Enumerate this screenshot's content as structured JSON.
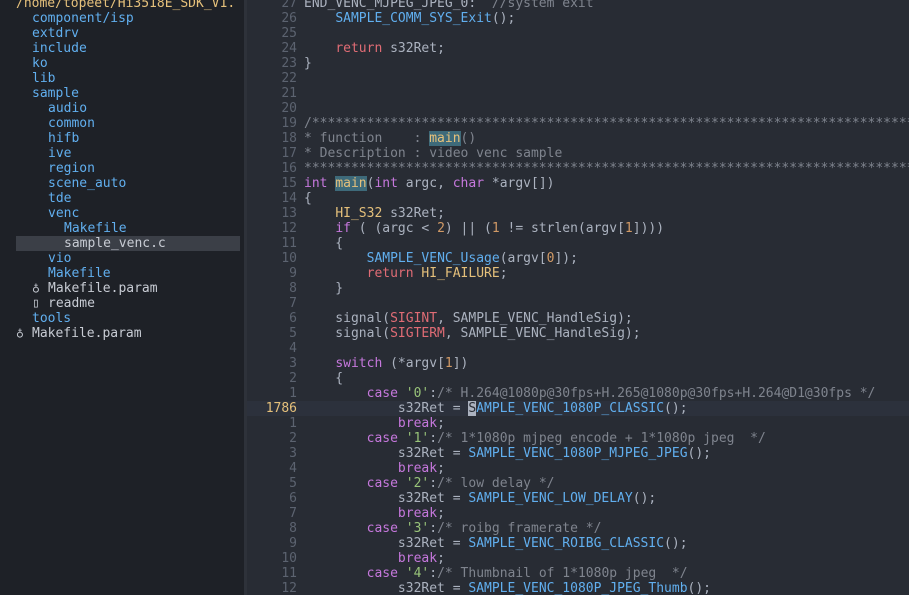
{
  "sidebar": {
    "items": [
      {
        "name": "/home/topeet/Hi3518E_SDK_V1.",
        "kind": "root",
        "depth": 0
      },
      {
        "name": "component/isp",
        "kind": "dir",
        "depth": 1
      },
      {
        "name": "extdrv",
        "kind": "dir",
        "depth": 1
      },
      {
        "name": "include",
        "kind": "dir",
        "depth": 1
      },
      {
        "name": "ko",
        "kind": "dir",
        "depth": 1
      },
      {
        "name": "lib",
        "kind": "dir",
        "depth": 1
      },
      {
        "name": "sample",
        "kind": "dir",
        "depth": 1
      },
      {
        "name": "audio",
        "kind": "dir",
        "depth": 2
      },
      {
        "name": "common",
        "kind": "dir",
        "depth": 2
      },
      {
        "name": "hifb",
        "kind": "dir",
        "depth": 2
      },
      {
        "name": "ive",
        "kind": "dir",
        "depth": 2
      },
      {
        "name": "region",
        "kind": "dir",
        "depth": 2
      },
      {
        "name": "scene_auto",
        "kind": "dir",
        "depth": 2
      },
      {
        "name": "tde",
        "kind": "dir",
        "depth": 2
      },
      {
        "name": "venc",
        "kind": "dir",
        "depth": 2
      },
      {
        "name": "Makefile",
        "kind": "dir",
        "depth": 3
      },
      {
        "name": "sample_venc.c",
        "kind": "file",
        "depth": 3,
        "selected": true
      },
      {
        "name": "vio",
        "kind": "dir",
        "depth": 2
      },
      {
        "name": "Makefile",
        "kind": "dir",
        "depth": 2
      },
      {
        "name": "Makefile.param",
        "kind": "file",
        "depth": 2,
        "glyph": "♁"
      },
      {
        "name": "readme",
        "kind": "file",
        "depth": 2,
        "glyph": "▯"
      },
      {
        "name": "tools",
        "kind": "dir",
        "depth": 1
      },
      {
        "name": "Makefile.param",
        "kind": "file",
        "depth": 1,
        "glyph": "♁"
      }
    ]
  },
  "editor": {
    "lines": [
      {
        "n": "27",
        "s": [
          [
            "END_VENC_MJPEG_JPEG_0:  ",
            ""
          ],
          [
            "//system exit",
            "cm"
          ]
        ]
      },
      {
        "n": "26",
        "s": [
          [
            "    ",
            ""
          ],
          [
            "SAMPLE_COMM_SYS_Exit",
            "fn"
          ],
          [
            "();",
            ""
          ]
        ]
      },
      {
        "n": "25",
        "s": []
      },
      {
        "n": "24",
        "s": [
          [
            "    ",
            ""
          ],
          [
            "return",
            "mac"
          ],
          [
            " s32Ret;",
            ""
          ]
        ]
      },
      {
        "n": "23",
        "s": [
          [
            "}",
            ""
          ]
        ]
      },
      {
        "n": "22",
        "s": []
      },
      {
        "n": "21",
        "s": []
      },
      {
        "n": "20",
        "s": []
      },
      {
        "n": "19",
        "s": [
          [
            "/**************************************************************************************",
            "cm"
          ]
        ]
      },
      {
        "n": "18",
        "s": [
          [
            "* function    : ",
            "cm"
          ],
          [
            "main",
            "hl"
          ],
          [
            "()",
            "cm"
          ]
        ]
      },
      {
        "n": "17",
        "s": [
          [
            "* Description : video venc sample",
            "cm"
          ]
        ]
      },
      {
        "n": "16",
        "s": [
          [
            "**************************************************************************************",
            "cm"
          ]
        ]
      },
      {
        "n": "15",
        "s": [
          [
            "int",
            "k"
          ],
          [
            " ",
            ""
          ],
          [
            "main",
            "hl"
          ],
          [
            "(",
            ""
          ],
          [
            "int",
            "k"
          ],
          [
            " argc, ",
            ""
          ],
          [
            "char",
            "k"
          ],
          [
            " *argv[])",
            ""
          ]
        ]
      },
      {
        "n": "14",
        "s": [
          [
            "{",
            ""
          ]
        ]
      },
      {
        "n": "13",
        "s": [
          [
            "    ",
            ""
          ],
          [
            "HI_S32",
            "t"
          ],
          [
            " s32Ret;",
            ""
          ]
        ]
      },
      {
        "n": "12",
        "s": [
          [
            "    ",
            ""
          ],
          [
            "if",
            "k"
          ],
          [
            " ( (argc < ",
            ""
          ],
          [
            "2",
            "cn"
          ],
          [
            ") || (",
            ""
          ],
          [
            "1",
            "cn"
          ],
          [
            " != strlen(argv[",
            ""
          ],
          [
            "1",
            "cn"
          ],
          [
            "])))",
            ""
          ]
        ]
      },
      {
        "n": "11",
        "s": [
          [
            "    {",
            ""
          ]
        ]
      },
      {
        "n": "10",
        "s": [
          [
            "        ",
            ""
          ],
          [
            "SAMPLE_VENC_Usage",
            "fn"
          ],
          [
            "(argv[",
            ""
          ],
          [
            "0",
            "cn"
          ],
          [
            "]);",
            ""
          ]
        ]
      },
      {
        "n": "9",
        "s": [
          [
            "        ",
            ""
          ],
          [
            "return",
            "mac"
          ],
          [
            " ",
            ""
          ],
          [
            "HI_FAILURE",
            "t"
          ],
          [
            ";",
            ""
          ]
        ]
      },
      {
        "n": "8",
        "s": [
          [
            "    }",
            ""
          ]
        ]
      },
      {
        "n": "7",
        "s": []
      },
      {
        "n": "6",
        "s": [
          [
            "    signal(",
            ""
          ],
          [
            "SIGINT",
            "mac"
          ],
          [
            ", SAMPLE_VENC_HandleSig);",
            ""
          ]
        ]
      },
      {
        "n": "5",
        "s": [
          [
            "    signal(",
            ""
          ],
          [
            "SIGTERM",
            "mac"
          ],
          [
            ", SAMPLE_VENC_HandleSig);",
            ""
          ]
        ]
      },
      {
        "n": "4",
        "s": []
      },
      {
        "n": "3",
        "s": [
          [
            "    ",
            ""
          ],
          [
            "switch",
            "k"
          ],
          [
            " (*argv[",
            ""
          ],
          [
            "1",
            "cn"
          ],
          [
            "])",
            ""
          ]
        ]
      },
      {
        "n": "2",
        "s": [
          [
            "    {",
            ""
          ]
        ]
      },
      {
        "n": "1",
        "s": [
          [
            "        ",
            ""
          ],
          [
            "case",
            "k"
          ],
          [
            " ",
            ""
          ],
          [
            "'0'",
            "str"
          ],
          [
            ":",
            ""
          ],
          [
            "/* H.264@1080p@30fps+H.265@1080p@30fps+H.264@D1@30fps */",
            "cm"
          ]
        ]
      },
      {
        "n": "1786",
        "cur": true,
        "s": [
          [
            "            s32Ret = ",
            ""
          ],
          [
            "S",
            "cursor"
          ],
          [
            "AMPLE_VENC_1080P_CLASSIC",
            "fn"
          ],
          [
            "();",
            ""
          ]
        ]
      },
      {
        "n": "1",
        "s": [
          [
            "            ",
            ""
          ],
          [
            "break",
            "k"
          ],
          [
            ";",
            ""
          ]
        ]
      },
      {
        "n": "2",
        "s": [
          [
            "        ",
            ""
          ],
          [
            "case",
            "k"
          ],
          [
            " ",
            ""
          ],
          [
            "'1'",
            "str"
          ],
          [
            ":",
            ""
          ],
          [
            "/* 1*1080p mjpeg encode + 1*1080p jpeg  */",
            "cm"
          ]
        ]
      },
      {
        "n": "3",
        "s": [
          [
            "            s32Ret = ",
            ""
          ],
          [
            "SAMPLE_VENC_1080P_MJPEG_JPEG",
            "fn"
          ],
          [
            "();",
            ""
          ]
        ]
      },
      {
        "n": "4",
        "s": [
          [
            "            ",
            ""
          ],
          [
            "break",
            "k"
          ],
          [
            ";",
            ""
          ]
        ]
      },
      {
        "n": "5",
        "s": [
          [
            "        ",
            ""
          ],
          [
            "case",
            "k"
          ],
          [
            " ",
            ""
          ],
          [
            "'2'",
            "str"
          ],
          [
            ":",
            ""
          ],
          [
            "/* low delay */",
            "cm"
          ]
        ]
      },
      {
        "n": "6",
        "s": [
          [
            "            s32Ret = ",
            ""
          ],
          [
            "SAMPLE_VENC_LOW_DELAY",
            "fn"
          ],
          [
            "();",
            ""
          ]
        ]
      },
      {
        "n": "7",
        "s": [
          [
            "            ",
            ""
          ],
          [
            "break",
            "k"
          ],
          [
            ";",
            ""
          ]
        ]
      },
      {
        "n": "8",
        "s": [
          [
            "        ",
            ""
          ],
          [
            "case",
            "k"
          ],
          [
            " ",
            ""
          ],
          [
            "'3'",
            "str"
          ],
          [
            ":",
            ""
          ],
          [
            "/* roibg framerate */",
            "cm"
          ]
        ]
      },
      {
        "n": "9",
        "s": [
          [
            "            s32Ret = ",
            ""
          ],
          [
            "SAMPLE_VENC_ROIBG_CLASSIC",
            "fn"
          ],
          [
            "();",
            ""
          ]
        ]
      },
      {
        "n": "10",
        "s": [
          [
            "            ",
            ""
          ],
          [
            "break",
            "k"
          ],
          [
            ";",
            ""
          ]
        ]
      },
      {
        "n": "11",
        "s": [
          [
            "        ",
            ""
          ],
          [
            "case",
            "k"
          ],
          [
            " ",
            ""
          ],
          [
            "'4'",
            "str"
          ],
          [
            ":",
            ""
          ],
          [
            "/* Thumbnail of 1*1080p jpeg  */",
            "cm"
          ]
        ]
      },
      {
        "n": "12",
        "s": [
          [
            "            s32Ret = ",
            ""
          ],
          [
            "SAMPLE_VENC_1080P_JPEG_Thumb",
            "fn"
          ],
          [
            "();",
            ""
          ]
        ]
      }
    ]
  },
  "colors": {
    "sidebar_bg": "#1e2127",
    "editor_bg": "#282c34",
    "cursorline_bg": "#2c313c",
    "dir": "#61afef",
    "root": "#e5c07b",
    "keyword": "#c678dd",
    "type": "#e5c07b",
    "string": "#98c379",
    "comment": "#7f848e"
  }
}
